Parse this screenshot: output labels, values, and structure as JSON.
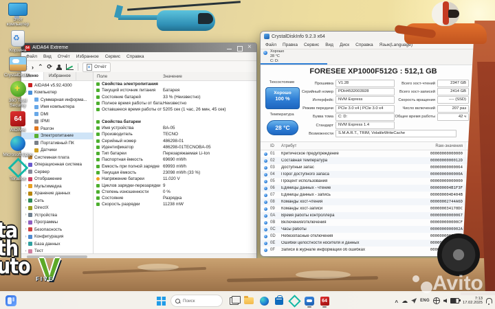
{
  "wallpaper": {
    "watermark": "Avito",
    "gta_lines": [
      "ta",
      "th",
      "uto"
    ],
    "gta_v": "V",
    "gta_five": "FIVE"
  },
  "desktop_icons": [
    {
      "name": "this-pc",
      "label": "Этот компьютер"
    },
    {
      "name": "recycle-bin",
      "label": "Корзина"
    },
    {
      "name": "crystaldiskinfo",
      "label": "CrystalDiskI..."
    },
    {
      "name": "360-total-security",
      "label": "360 Total Security"
    },
    {
      "name": "aida64",
      "label": "AIDA64"
    },
    {
      "name": "edge",
      "label": "Microsoft Edge"
    },
    {
      "name": "terabox",
      "label": "TeraBox"
    }
  ],
  "aida": {
    "window_title": "AIDA64 Extreme",
    "menu": [
      "Файл",
      "Вид",
      "Отчёт",
      "Избранное",
      "Сервис",
      "Справка"
    ],
    "report_button": "Отчёт",
    "tabs": [
      "Меню",
      "Избранное"
    ],
    "columns": {
      "field": "Поле",
      "value": "Значение"
    },
    "tree": [
      {
        "label": "AIDA64 v5.92.4300",
        "depth": 0,
        "icon": "aida",
        "expand": ""
      },
      {
        "label": "Компьютер",
        "depth": 0,
        "icon": "computer",
        "expand": "v"
      },
      {
        "label": "Суммарная информа...",
        "depth": 1,
        "icon": "page",
        "expand": ""
      },
      {
        "label": "Имя компьютера",
        "depth": 1,
        "icon": "page",
        "expand": ""
      },
      {
        "label": "DMI",
        "depth": 1,
        "icon": "page",
        "expand": ""
      },
      {
        "label": "IPMI",
        "depth": 1,
        "icon": "chip",
        "expand": ""
      },
      {
        "label": "Разгон",
        "depth": 1,
        "icon": "speed",
        "expand": ""
      },
      {
        "label": "Электропитание",
        "depth": 1,
        "icon": "power",
        "expand": "",
        "selected": true
      },
      {
        "label": "Портативный ПК",
        "depth": 1,
        "icon": "laptop",
        "expand": ""
      },
      {
        "label": "Датчики",
        "depth": 1,
        "icon": "sensor",
        "expand": ""
      },
      {
        "label": "Системная плата",
        "depth": 0,
        "icon": "board",
        "expand": ">"
      },
      {
        "label": "Операционная система",
        "depth": 0,
        "icon": "os",
        "expand": ">"
      },
      {
        "label": "Сервер",
        "depth": 0,
        "icon": "server",
        "expand": ">"
      },
      {
        "label": "Отображение",
        "depth": 0,
        "icon": "display",
        "expand": ">"
      },
      {
        "label": "Мультимедиа",
        "depth": 0,
        "icon": "media",
        "expand": ">"
      },
      {
        "label": "Хранение данных",
        "depth": 0,
        "icon": "storage",
        "expand": ">"
      },
      {
        "label": "Сеть",
        "depth": 0,
        "icon": "network",
        "expand": ">"
      },
      {
        "label": "DirectX",
        "depth": 0,
        "icon": "directx",
        "expand": ">"
      },
      {
        "label": "Устройства",
        "depth": 0,
        "icon": "devices",
        "expand": ">"
      },
      {
        "label": "Программы",
        "depth": 0,
        "icon": "programs",
        "expand": ">"
      },
      {
        "label": "Безопасность",
        "depth": 0,
        "icon": "security",
        "expand": ">"
      },
      {
        "label": "Конфигурация",
        "depth": 0,
        "icon": "config",
        "expand": ">"
      },
      {
        "label": "База данных",
        "depth": 0,
        "icon": "database",
        "expand": ">"
      },
      {
        "label": "Тест",
        "depth": 0,
        "icon": "test",
        "expand": ">"
      }
    ],
    "sections": [
      {
        "title": "Свойства электропитания",
        "rows": [
          {
            "field": "Текущий источник питания",
            "value": "Батарея"
          },
          {
            "field": "Состояние батарей",
            "value": "33 % (Неизвестно)"
          },
          {
            "field": "Полное время работы от бата...",
            "value": "Неизвестно"
          },
          {
            "field": "Оставшееся время работы от ...",
            "value": "5205 сек (1 час, 26 мин, 45 сек)"
          }
        ]
      },
      {
        "title": "Свойства батареи",
        "rows": [
          {
            "field": "Имя устройства",
            "value": "BA-05"
          },
          {
            "field": "Производитель",
            "value": "TECNO"
          },
          {
            "field": "Серийный номер",
            "value": "486298-01"
          },
          {
            "field": "Идентификатор",
            "value": "486298-01TECNOBA-05"
          },
          {
            "field": "Тип батареи",
            "value": "Перезаряжаемая Li-Ion"
          },
          {
            "field": "Паспортная ёмкость",
            "value": "69690 mWh"
          },
          {
            "field": "Ёмкость при полной зарядке",
            "value": "69993 mWh"
          },
          {
            "field": "Текущая ёмкость",
            "value": "23098 mWh  (33 %)"
          },
          {
            "field": "Напряжение батареи",
            "value": "11.020 V",
            "icon": "voltage"
          },
          {
            "field": "Циклов зарядки-перезарядки",
            "value": "9"
          },
          {
            "field": "Степень изношенности",
            "value": "0 %"
          },
          {
            "field": "Состояние",
            "value": "Разрядка"
          },
          {
            "field": "Скорость разрядки",
            "value": "11238 mW"
          }
        ]
      }
    ]
  },
  "cdi": {
    "window_title": "CrystalDiskInfo 9.2.3 x64",
    "menu": [
      "Файл",
      "Правка",
      "Сервис",
      "Вид",
      "Диск",
      "Справка",
      "Язык(Language)"
    ],
    "drive_tab": {
      "status": "Хорошо",
      "temp": "28 °C",
      "letters": "C: D:"
    },
    "disk_title": "FORESEE XP1000F512G : 512,1 GB",
    "health": {
      "label": "Техсостояние",
      "status": "Хорошо",
      "percent": "100 %"
    },
    "temperature": {
      "label": "Температура",
      "value": "28 °C"
    },
    "fields_left": [
      {
        "label": "Прошивка",
        "value": "V1.28"
      },
      {
        "label": "Серийный номер",
        "value": "PDH4532003928"
      },
      {
        "label": "Интерфейс",
        "value": "NVM Express"
      },
      {
        "label": "Режим передачи",
        "value": "PCIe 3.0 x4 | PCIe 3.0 x4"
      },
      {
        "label": "Буква тома",
        "value": "C: D:"
      },
      {
        "label": "Стандарт",
        "value": "NVM Express 1.4"
      },
      {
        "label": "Возможности",
        "value": "S.M.A.R.T., TRIM, VolatileWriteCache",
        "wide": true
      }
    ],
    "fields_right": [
      {
        "label": "Всего хост-чтений",
        "value": "2347 GB"
      },
      {
        "label": "Всего хост-записей",
        "value": "2414 GB"
      },
      {
        "label": "Скорость вращения",
        "value": "---- (SSD)"
      },
      {
        "label": "Число включений",
        "value": "207 раз"
      },
      {
        "label": "Общее время работы",
        "value": "42 ч"
      }
    ],
    "table": {
      "headers": {
        "id": "ID",
        "attr": "Атрибут",
        "raw": "Raw-значения"
      },
      "rows": [
        {
          "id": "01",
          "attr": "Критическое предупреждение",
          "raw": "00000000000000"
        },
        {
          "id": "02",
          "attr": "Составная температура",
          "raw": "0000000000012D"
        },
        {
          "id": "03",
          "attr": "Доступный запас",
          "raw": "00000000000064"
        },
        {
          "id": "04",
          "attr": "Порог доступного запаса",
          "raw": "0000000000000A"
        },
        {
          "id": "05",
          "attr": "Процент использования",
          "raw": "00000000000000"
        },
        {
          "id": "06",
          "attr": "Единицы данных - чтение",
          "raw": "000000004B1F3F"
        },
        {
          "id": "07",
          "attr": "Единицы данных - запись",
          "raw": "000000004D404B"
        },
        {
          "id": "08",
          "attr": "Команды хост-чтения",
          "raw": "00000002744A6D"
        },
        {
          "id": "09",
          "attr": "Команды хост-записи",
          "raw": "000000034170DC"
        },
        {
          "id": "0A",
          "attr": "Время работы контроллера",
          "raw": "00000000000067"
        },
        {
          "id": "0B",
          "attr": "Включения/отключения",
          "raw": "000000000000CF"
        },
        {
          "id": "0C",
          "attr": "Часы работы",
          "raw": "0000000000002A"
        },
        {
          "id": "0D",
          "attr": "Небезопасные отключения",
          "raw": "00000000000004"
        },
        {
          "id": "0E",
          "attr": "Ошибки целостности носителя и данных",
          "raw": "00000000000000"
        },
        {
          "id": "0F",
          "attr": "Записи в журнале информации об ошибках",
          "raw": "00000000000000"
        }
      ]
    }
  },
  "taskbar": {
    "search_placeholder": "Поиск",
    "buttons": [
      "taskview",
      "folder",
      "edge",
      "store",
      "terabox",
      "cdi",
      "aida64"
    ],
    "running": [
      "cdi",
      "aida64"
    ],
    "tray_lang": "ENG",
    "time": "7:13",
    "date": "17.02.2025"
  }
}
